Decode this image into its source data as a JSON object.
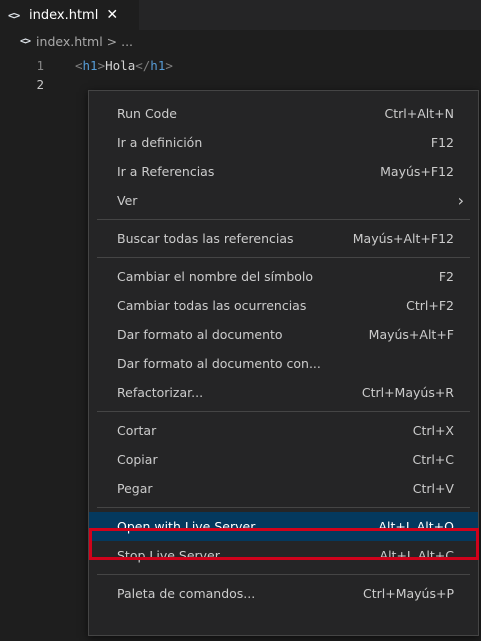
{
  "tab": {
    "icon": "<>",
    "label": "index.html",
    "close": "✕"
  },
  "breadcrumb": {
    "icon": "<>",
    "path": "index.html > ..."
  },
  "editor": {
    "lines": [
      {
        "number": "1",
        "open_tag_start": "<",
        "open_tag": "h1",
        "open_tag_end": ">",
        "text": "Hola",
        "close_tag_start": "</",
        "close_tag": "h1",
        "close_tag_end": ">"
      },
      {
        "number": "2"
      }
    ]
  },
  "menu": {
    "groups": [
      [
        {
          "label": "Run Code",
          "shortcut": "Ctrl+Alt+N"
        },
        {
          "label": "Ir a definición",
          "shortcut": "F12"
        },
        {
          "label": "Ir a Referencias",
          "shortcut": "Mayús+F12"
        },
        {
          "label": "Ver",
          "shortcut": "›"
        }
      ],
      [
        {
          "label": "Buscar todas las referencias",
          "shortcut": "Mayús+Alt+F12"
        }
      ],
      [
        {
          "label": "Cambiar el nombre del símbolo",
          "shortcut": "F2"
        },
        {
          "label": "Cambiar todas las ocurrencias",
          "shortcut": "Ctrl+F2"
        },
        {
          "label": "Dar formato al documento",
          "shortcut": "Mayús+Alt+F"
        },
        {
          "label": "Dar formato al documento con...",
          "shortcut": ""
        },
        {
          "label": "Refactorizar...",
          "shortcut": "Ctrl+Mayús+R"
        }
      ],
      [
        {
          "label": "Cortar",
          "shortcut": "Ctrl+X"
        },
        {
          "label": "Copiar",
          "shortcut": "Ctrl+C"
        },
        {
          "label": "Pegar",
          "shortcut": "Ctrl+V"
        }
      ],
      [
        {
          "label": "Open with Live Server",
          "shortcut": "Alt+L Alt+O",
          "highlighted": true
        },
        {
          "label": "Stop Live Server",
          "shortcut": "Alt+L Alt+C"
        }
      ],
      [
        {
          "label": "Paleta de comandos...",
          "shortcut": "Ctrl+Mayús+P"
        }
      ]
    ]
  },
  "colors": {
    "highlight": "#04395e",
    "annotation_box": "#d0021b"
  }
}
